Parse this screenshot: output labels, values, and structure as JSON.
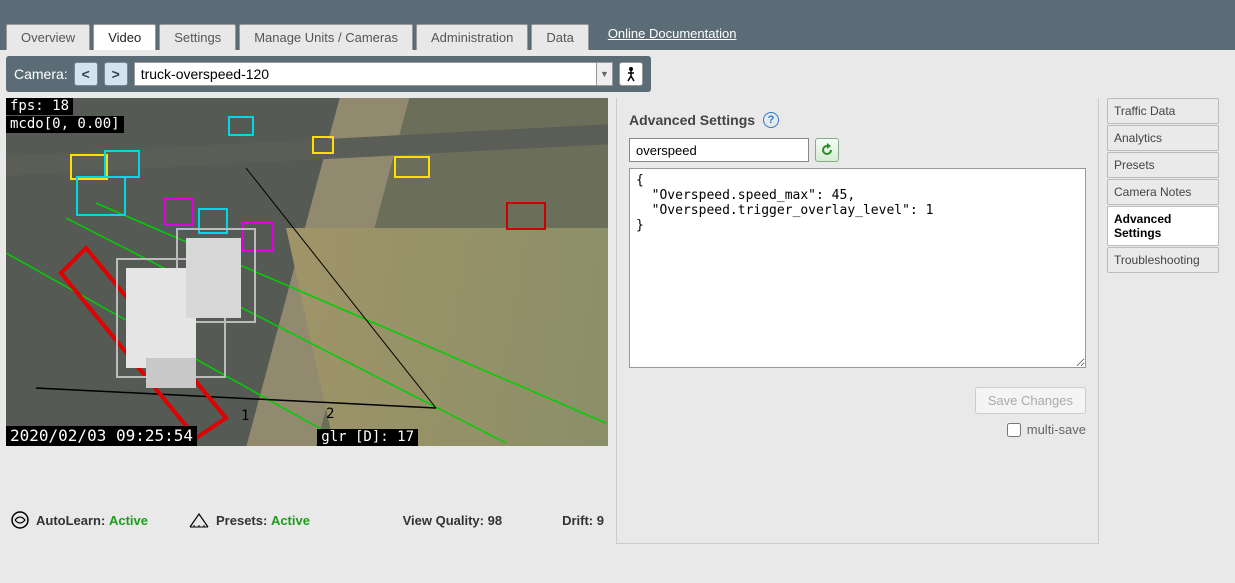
{
  "tabs": [
    "Overview",
    "Video",
    "Settings",
    "Manage Units / Cameras",
    "Administration",
    "Data"
  ],
  "activeTab": 1,
  "docLink": "Online Documentation",
  "camera": {
    "label": "Camera:",
    "prev": "<",
    "next": ">",
    "value": "truck-overspeed-120"
  },
  "overlay": {
    "fps": "fps: 18",
    "mcdo": "mcdo[0, 0.00]",
    "timestamp": "2020/02/03 09:25:54",
    "glr": "glr [D]: 17",
    "lane1": "1",
    "lane2": "2"
  },
  "status": {
    "autolearnLabel": "AutoLearn:",
    "autolearnStatus": "Active",
    "presetsLabel": "Presets:",
    "presetsStatus": "Active",
    "viewQualityLabel": "View Quality:",
    "viewQualityValue": "98",
    "driftLabel": "Drift:",
    "driftValue": "9"
  },
  "panel": {
    "title": "Advanced Settings",
    "filterValue": "overspeed",
    "code": "{\n  \"Overspeed.speed_max\": 45,\n  \"Overspeed.trigger_overlay_level\": 1\n}",
    "save": "Save Changes",
    "multisave": "multi-save"
  },
  "side": [
    "Traffic Data",
    "Analytics",
    "Presets",
    "Camera Notes",
    "Advanced Settings",
    "Troubleshooting"
  ],
  "sideActive": 4
}
